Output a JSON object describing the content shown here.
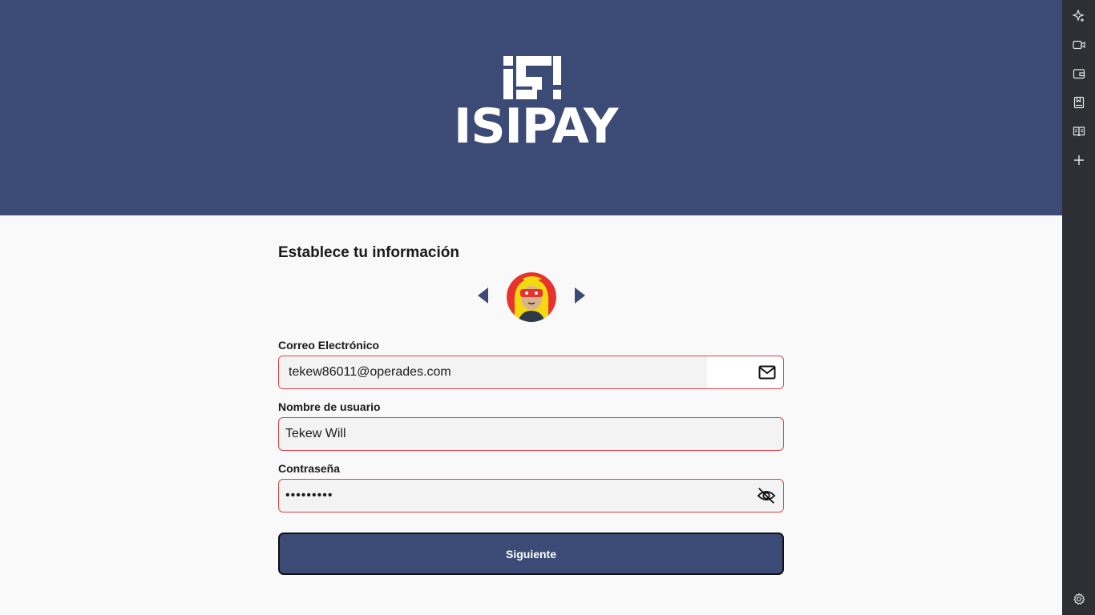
{
  "app": {
    "name": "ISIPAY"
  },
  "form": {
    "title": "Establece tu información",
    "email": {
      "label": "Correo Electrónico",
      "value": "tekew86011@operades.com"
    },
    "username": {
      "label": "Nombre de usuario",
      "value": "Tekew Will"
    },
    "password": {
      "label": "Contraseña",
      "value": "•••••••••"
    },
    "submit_label": "Siguiente"
  },
  "icons": {
    "avatar_prev": "caret-left-icon",
    "avatar_next": "caret-right-icon",
    "email": "envelope-icon",
    "password_toggle": "eye-off-icon",
    "sidebar": [
      "sparkle-add-icon",
      "video-icon",
      "wallet-icon",
      "bookmark-icon",
      "book-icon",
      "plus-icon",
      "settings-icon"
    ]
  },
  "colors": {
    "brand": "#3b4b76",
    "field_error_border": "#d9434a",
    "sidebar_bg": "#2e2f35"
  }
}
